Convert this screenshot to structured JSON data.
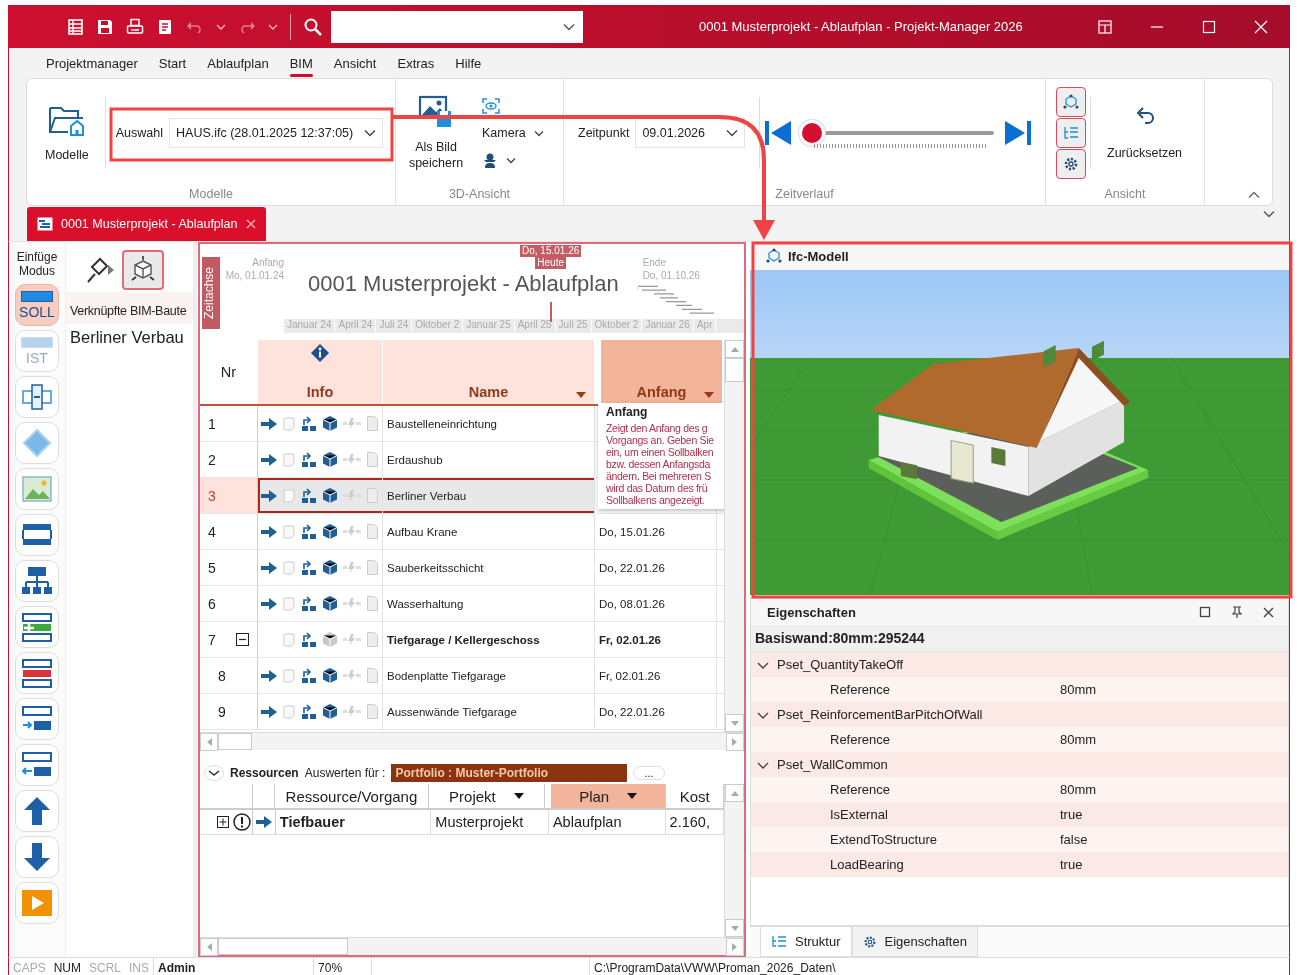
{
  "title_bar": {
    "title": "0001 Musterprojekt - Ablaufplan - Projekt-Manager 2026"
  },
  "menu_tabs": [
    {
      "label": "Projektmanager",
      "selected": false
    },
    {
      "label": "Start",
      "selected": false
    },
    {
      "label": "Ablaufplan",
      "selected": false
    },
    {
      "label": "BIM",
      "selected": true
    },
    {
      "label": "Ansicht",
      "selected": false
    },
    {
      "label": "Extras",
      "selected": false
    },
    {
      "label": "Hilfe",
      "selected": false
    }
  ],
  "ribbon": {
    "models": {
      "button": "Modelle",
      "selection_label": "Auswahl",
      "selection_value": "HAUS.ifc (28.01.2025 12:37:05)",
      "group": "Modelle"
    },
    "view_3d": {
      "save_image": "Als Bild speichern",
      "camera": "Kamera",
      "group": "3D-Ansicht"
    },
    "timeline": {
      "label": "Zeitpunkt",
      "value": "09.01.2026",
      "level": 0.0,
      "group": "Zeitverlauf"
    },
    "view": {
      "reset": "Zurücksetzen",
      "group": "Ansicht"
    }
  },
  "document_tab": {
    "title": "0001 Musterprojekt - Ablaufplan"
  },
  "insert_mode": {
    "label": "Einfüge Modus",
    "modes": [
      {
        "label": "SOLL",
        "selected": true
      },
      {
        "label": "IST",
        "selected": false
      }
    ]
  },
  "linked_panel": {
    "title": "Verknüpfte BIM-Baute",
    "item": "Berliner Verbau"
  },
  "gantt_header": {
    "axis_label": "Zeitachse",
    "start_label": "Anfang",
    "start_date": "Mo, 01.01.24",
    "title": "0001 Musterprojekt - Ablaufplan",
    "today_date": "Do, 15.01.26",
    "today_label": "Heute",
    "end_label": "Ende",
    "end_date": "Do, 01.10.26",
    "months": [
      "Januar 24",
      "April 24",
      "Juli 24",
      "Oktober 2",
      "Januar 25",
      "April 25",
      "Juli 25",
      "Oktober 2",
      "Januar 26",
      "Apr"
    ]
  },
  "table": {
    "columns": [
      {
        "label": "Nr",
        "filter": false,
        "selected": false
      },
      {
        "label": "Info",
        "filter": false,
        "selected": false
      },
      {
        "label": "Name",
        "filter": true,
        "selected": false
      },
      {
        "label": "Anfang",
        "filter": true,
        "selected": true
      }
    ],
    "rows": [
      {
        "nr": "1",
        "kind": "task",
        "name": "Baustelleneinrichtung",
        "selected": false
      },
      {
        "nr": "2",
        "kind": "task",
        "name": "Erdaushub",
        "selected": false
      },
      {
        "nr": "3",
        "kind": "task",
        "name": "Berliner Verbau",
        "selected": true
      },
      {
        "nr": "4",
        "kind": "task",
        "name": "Aufbau Krane",
        "start": "Do, 15.01.26",
        "selected": false
      },
      {
        "nr": "5",
        "kind": "task",
        "name": "Sauberkeitsschicht",
        "start": "Do, 22.01.26",
        "selected": false
      },
      {
        "nr": "6",
        "kind": "task",
        "name": "Wasserhaltung",
        "start": "Do, 08.01.26",
        "selected": false
      },
      {
        "nr": "7",
        "kind": "summary",
        "name": "Tiefgarage / Kellergeschoss",
        "start": "Fr, 02.01.26",
        "selected": false,
        "expanded": true,
        "children": [
          {
            "nr": "8",
            "kind": "task",
            "name": "Bodenplatte Tiefgarage",
            "start": "Fr, 02.01.26",
            "selected": false
          },
          {
            "nr": "9",
            "kind": "task",
            "name": "Aussenwände Tiefgarage",
            "start": "Do, 22.01.26",
            "selected": false
          }
        ]
      }
    ]
  },
  "tooltip": {
    "title": "Anfang",
    "lines": [
      "Zeigt den Anfang des g",
      "Vorgangs an. Geben Sie",
      "ein, um einen Sollbalken",
      "bzw. dessen Anfangsda",
      "ändern. Bei mehreren S",
      "wird das Datum des frü",
      "Sollbalkens angezeigt."
    ]
  },
  "resources": {
    "title": "Ressourcen",
    "evaluate_label": "Auswerten für :",
    "portfolio": "Portfolio : Muster-Portfolio",
    "more": "...",
    "columns": [
      {
        "label": "Ressource/Vorgang",
        "filter": false,
        "selected": false
      },
      {
        "label": "Projekt",
        "filter": true,
        "selected": false
      },
      {
        "label": "Plan",
        "filter": true,
        "selected": true
      },
      {
        "label": "Kost",
        "filter": false,
        "selected": false
      }
    ],
    "rows": [
      {
        "expanded": false,
        "name": "Tiefbauer",
        "project": "Musterprojekt",
        "plan": "Ablaufplan",
        "cost": "2.160,"
      }
    ]
  },
  "model_view": {
    "title": "Ifc-Modell"
  },
  "properties": {
    "title": "Eigenschaften",
    "object": "Basiswand:80mm:295244",
    "groups": [
      {
        "name": "Pset_QuantityTakeOff",
        "expanded": true,
        "children": [
          {
            "name": "Reference",
            "value": "80mm"
          }
        ]
      },
      {
        "name": "Pset_ReinforcementBarPitchOfWall",
        "expanded": true,
        "children": [
          {
            "name": "Reference",
            "value": "80mm"
          }
        ]
      },
      {
        "name": "Pset_WallCommon",
        "expanded": true,
        "children": [
          {
            "name": "Reference",
            "value": "80mm"
          },
          {
            "name": "IsExternal",
            "value": "true"
          },
          {
            "name": "ExtendToStructure",
            "value": "false"
          },
          {
            "name": "LoadBearing",
            "value": "true"
          }
        ]
      }
    ],
    "tabs": [
      {
        "kind": "structure",
        "label": "Struktur",
        "selected": false
      },
      {
        "kind": "properties",
        "label": "Eigenschaften",
        "selected": true
      }
    ]
  },
  "status_bar": {
    "indicators": [
      {
        "label": "CAPS",
        "on": false
      },
      {
        "label": "NUM",
        "on": true
      },
      {
        "label": "SCRL",
        "on": false
      },
      {
        "label": "INS",
        "on": false
      }
    ],
    "user": "Admin",
    "zoom": "70%",
    "path": "C:\\ProgramData\\VWW\\Proman_2026_Daten\\"
  }
}
